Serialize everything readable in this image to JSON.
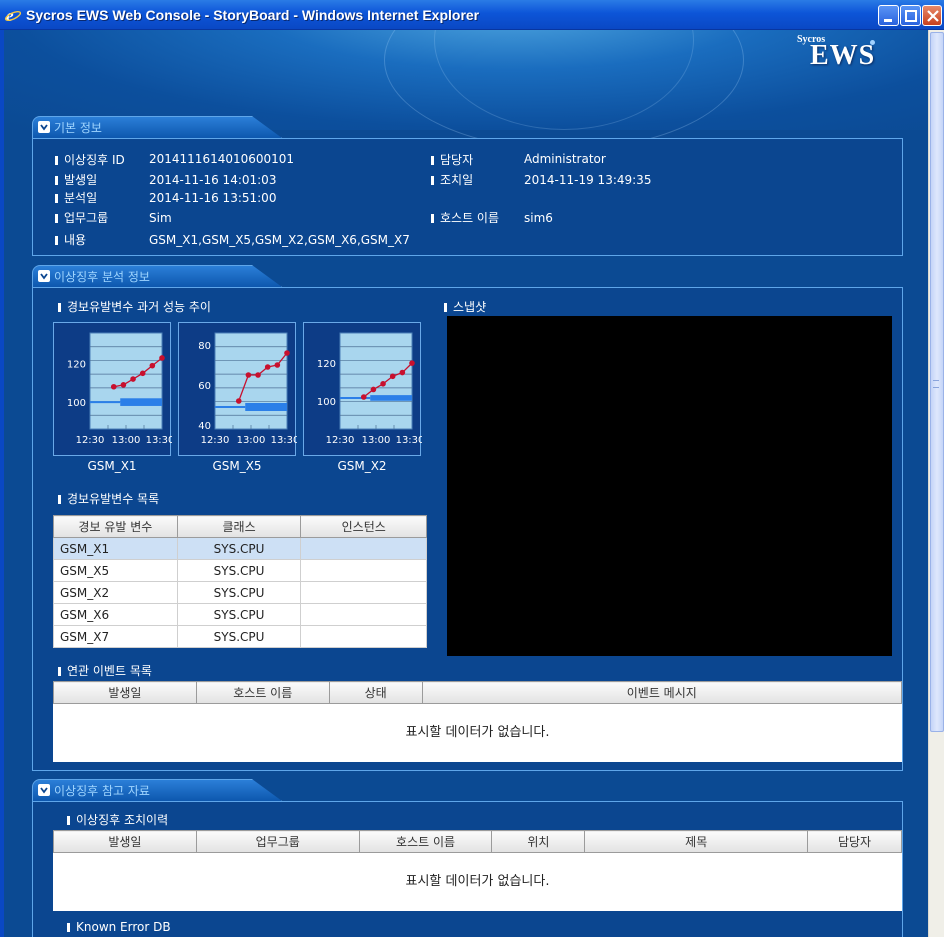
{
  "window": {
    "title": "Sycros EWS Web Console - StoryBoard - Windows Internet Explorer"
  },
  "logo": {
    "small": "Sycros",
    "big": "EWS"
  },
  "basic_info": {
    "section_title": "기본 정보",
    "fields": [
      {
        "label": "이상징후 ID",
        "value": "20141116140106001​01"
      },
      {
        "label": "발생일",
        "value": "2014-11-16 14:01:03"
      },
      {
        "label": "분석일",
        "value": "2014-11-16 13:51:00"
      },
      {
        "label": "업무그룹",
        "value": "Sim"
      },
      {
        "label": "내용",
        "value": "GSM_X1,GSM_X5,GSM_X2,GSM_X6,GSM_X7"
      }
    ],
    "right_fields": [
      {
        "label": "담당자",
        "value": "Administrator"
      },
      {
        "label": "조치일",
        "value": "2014-11-19 13:49:35"
      },
      {
        "label": "호스트 이름",
        "value": "sim6"
      }
    ]
  },
  "analysis": {
    "section_title": "이상징후 분석 정보",
    "trend_title": "경보유발변수 과거 성능 추이",
    "snapshot_title": "스냅샷",
    "var_list_title": "경보유발변수 목록",
    "var_table": {
      "headers": [
        "경보 유발 변수",
        "클래스",
        "인스턴스"
      ],
      "rows": [
        [
          "GSM_X1",
          "SYS.CPU",
          ""
        ],
        [
          "GSM_X5",
          "SYS.CPU",
          ""
        ],
        [
          "GSM_X2",
          "SYS.CPU",
          ""
        ],
        [
          "GSM_X6",
          "SYS.CPU",
          ""
        ],
        [
          "GSM_X7",
          "SYS.CPU",
          ""
        ]
      ]
    },
    "event_list_title": "연관 이벤트 목록",
    "event_table": {
      "headers": [
        "발생일",
        "호스트 이름",
        "상태",
        "이벤트 메시지"
      ],
      "empty_message": "표시할 데이터가 없습니다."
    }
  },
  "chart_data": [
    {
      "type": "line",
      "name": "GSM_X1",
      "x_ticks": [
        "12:30",
        "13:00",
        "13:30"
      ],
      "y_ticks": [
        100,
        120
      ],
      "ylim": [
        86,
        136
      ],
      "series": [
        {
          "values": [
            108,
            109,
            112,
            115,
            119,
            123
          ]
        }
      ],
      "band": {
        "from": 98,
        "to": 102
      },
      "grid": true
    },
    {
      "type": "line",
      "name": "GSM_X5",
      "x_ticks": [
        "12:30",
        "13:00",
        "13:30"
      ],
      "y_ticks": [
        40,
        60,
        80
      ],
      "ylim": [
        38,
        86
      ],
      "series": [
        {
          "values": [
            52,
            65,
            65,
            69,
            70,
            76
          ]
        }
      ],
      "band": {
        "from": 47,
        "to": 51
      },
      "grid": true
    },
    {
      "type": "line",
      "name": "GSM_X2",
      "x_ticks": [
        "12:30",
        "13:00",
        "13:30"
      ],
      "y_ticks": [
        100,
        120
      ],
      "ylim": [
        85,
        136
      ],
      "series": [
        {
          "values": [
            102,
            106,
            109,
            113,
            115,
            120
          ]
        }
      ],
      "band": {
        "from": 100,
        "to": 103
      },
      "grid": true
    }
  ],
  "reference": {
    "section_title": "이상징후 참고 자료",
    "history_title": "이상징후 조치이력",
    "history_table": {
      "headers": [
        "발생일",
        "업무그룹",
        "호스트 이름",
        "위치",
        "제목",
        "담당자"
      ],
      "empty_message": "표시할 데이터가 없습니다."
    },
    "known_error_title": "Known Error DB"
  },
  "colors": {
    "titlebar": "#0d55d8",
    "background": "#0b4a93",
    "section_label": "#9fd5ff",
    "chart_line": "#c8102e",
    "chart_band": "#2b7fe8"
  }
}
